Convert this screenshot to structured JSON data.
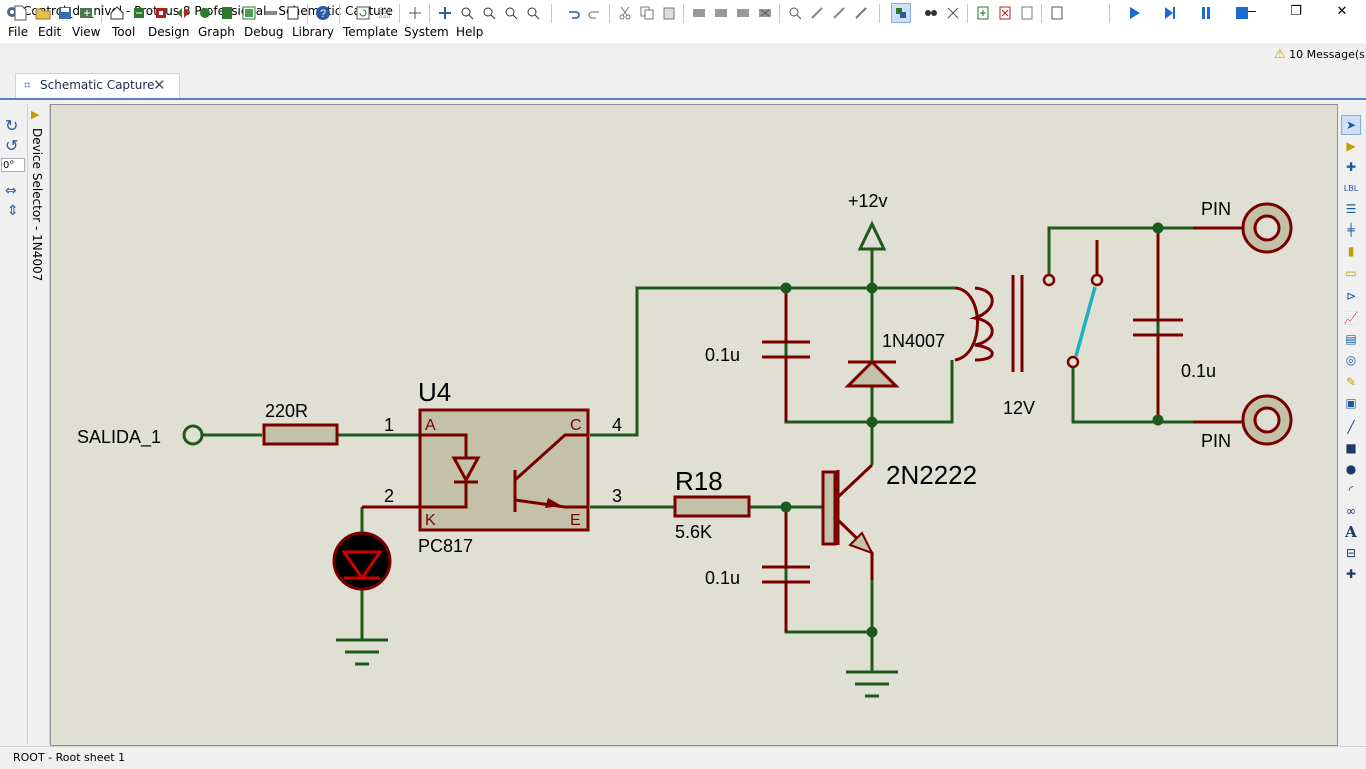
{
  "window": {
    "title": "Control_de_nivel - Proteus 8 Professional - Schematic Capture",
    "minimize": "—",
    "restore": "❐",
    "close": "✕"
  },
  "menu": [
    "File",
    "Edit",
    "View",
    "Tool",
    "Design",
    "Graph",
    "Debug",
    "Library",
    "Template",
    "System",
    "Help"
  ],
  "toolbar": {
    "messages_label": "10 Message(s)",
    "warning_icon": "⚠"
  },
  "tab": {
    "label": "Schematic Capture",
    "close": "✕"
  },
  "left_panel": {
    "device_selector_label": "Device Selector - 1N4007",
    "rotation_value": "0°"
  },
  "status": {
    "text": "ROOT - Root sheet 1"
  },
  "schematic": {
    "terminal_salida": "SALIDA_1",
    "r_220": "220R",
    "pin1": "1",
    "pin2": "2",
    "pin3": "3",
    "pin4": "4",
    "u4_ref": "U4",
    "u4_value": "PC817",
    "pin_a": "A",
    "pin_k": "K",
    "pin_c": "C",
    "pin_e": "E",
    "r18_ref": "R18",
    "r18_value": "5.6K",
    "cap1": "0.1u",
    "cap2": "0.1u",
    "cap3": "0.1u",
    "diode": "1N4007",
    "transistor": "2N2222",
    "power": "+12v",
    "relay": "12V",
    "pin_top": "PIN",
    "pin_bottom": "PIN"
  },
  "colors": {
    "wire": "#1e5a1e",
    "component": "#7a0000",
    "component_fill": "#c3c2a8",
    "canvas": "#e0dfd3",
    "relay_contact": "#20b0c0",
    "junction": "#1e5a1e"
  }
}
